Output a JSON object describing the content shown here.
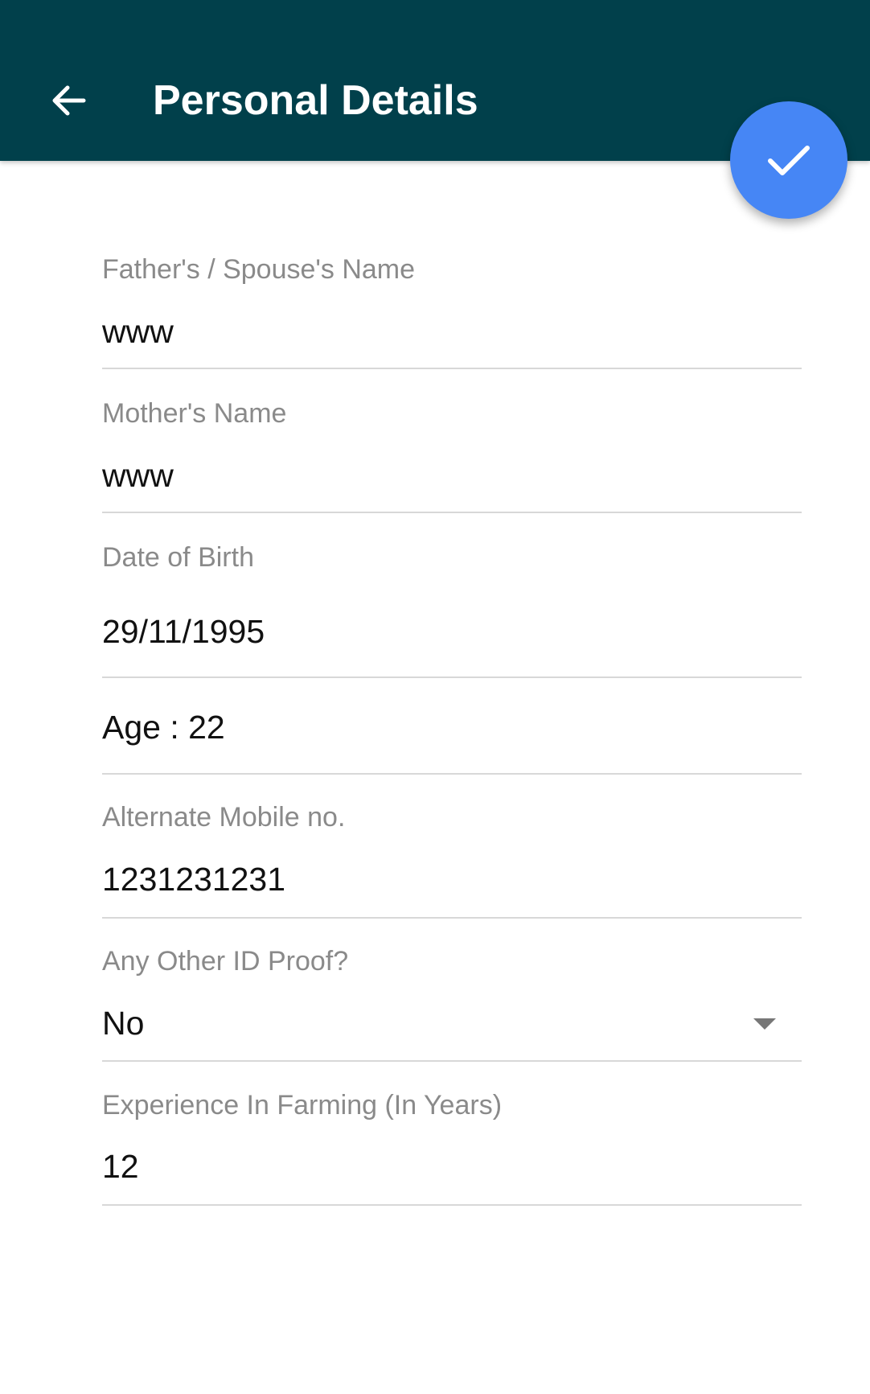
{
  "header": {
    "title": "Personal Details",
    "back_icon": "arrow-left-icon",
    "save_icon": "check-icon",
    "bar_color": "#01404b",
    "fab_color": "#4686f5"
  },
  "form": {
    "father_spouse_name": {
      "label": "Father's / Spouse's Name",
      "value": "www"
    },
    "mother_name": {
      "label": "Mother's Name",
      "value": "www"
    },
    "date_of_birth": {
      "label": "Date of Birth",
      "value": "29/11/1995"
    },
    "age": {
      "text": "Age : 22"
    },
    "alternate_mobile": {
      "label": "Alternate Mobile no.",
      "value": "1231231231"
    },
    "other_id_proof": {
      "label": "Any Other ID Proof?",
      "value": "No",
      "icon": "dropdown-arrow-icon"
    },
    "farming_experience": {
      "label": "Experience In Farming (In Years)",
      "value": "12"
    }
  }
}
